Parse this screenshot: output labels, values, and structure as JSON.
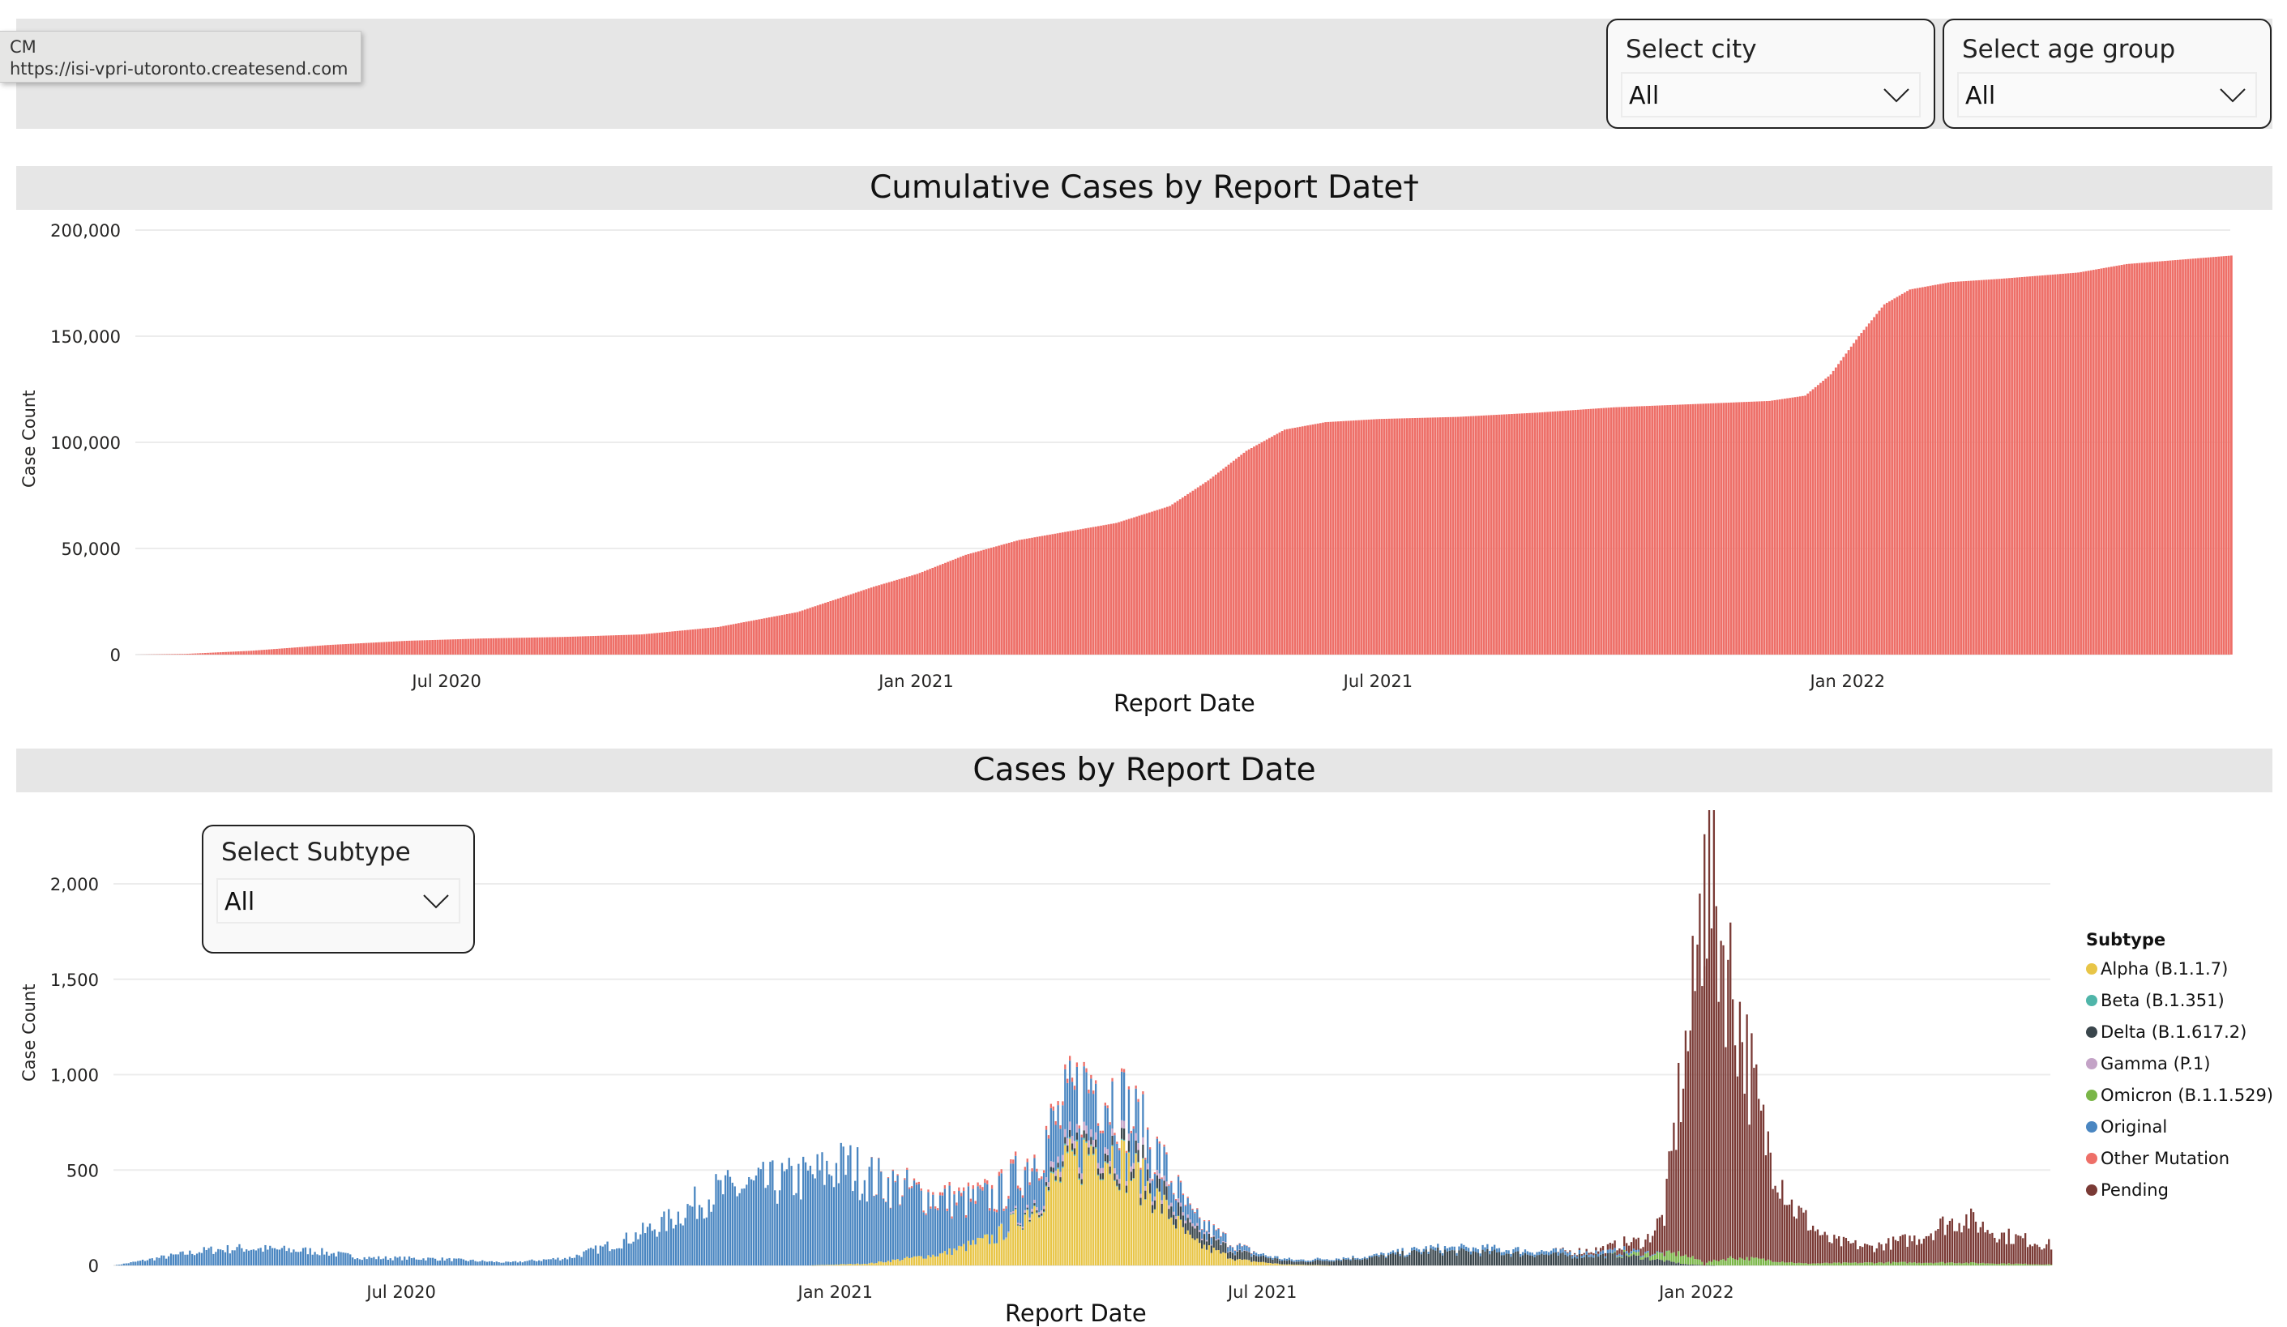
{
  "tooltip": {
    "line1": "CM",
    "line2": "https://isi-vpri-utoronto.createsend.com"
  },
  "filters": {
    "city": {
      "label": "Select city",
      "value": "All"
    },
    "age_group": {
      "label": "Select age group",
      "value": "All"
    },
    "subtype": {
      "label": "Select Subtype",
      "value": "All"
    }
  },
  "icons": {
    "dropdown": "chevron-down-icon",
    "legend_marker": "circle-icon"
  },
  "chart_data": [
    {
      "id": "cumulative",
      "type": "bar",
      "title": "Cumulative Cases by Report Date†",
      "xlabel": "Report Date",
      "ylabel": "Case Count",
      "x_range": [
        "2020-03-01",
        "2022-05-31"
      ],
      "ylim": [
        0,
        200000
      ],
      "yticks": [
        0,
        50000,
        100000,
        150000,
        200000
      ],
      "ytick_labels": [
        "0",
        "50,000",
        "100,000",
        "150,000",
        "200,000"
      ],
      "xticks": [
        "2020-07-01",
        "2021-01-01",
        "2021-07-01",
        "2022-01-01"
      ],
      "xtick_labels": [
        "Jul 2020",
        "Jan 2021",
        "Jul 2021",
        "Jan 2022"
      ],
      "grid": true,
      "color": "#EE6F68",
      "keypoints": [
        [
          "2020-03-01",
          0
        ],
        [
          "2020-03-20",
          300
        ],
        [
          "2020-04-15",
          1800
        ],
        [
          "2020-05-15",
          4500
        ],
        [
          "2020-06-15",
          6500
        ],
        [
          "2020-07-15",
          7600
        ],
        [
          "2020-08-15",
          8300
        ],
        [
          "2020-09-15",
          9500
        ],
        [
          "2020-10-15",
          13000
        ],
        [
          "2020-11-15",
          20000
        ],
        [
          "2020-12-15",
          32000
        ],
        [
          "2021-01-01",
          38000
        ],
        [
          "2021-01-20",
          47000
        ],
        [
          "2021-02-10",
          54000
        ],
        [
          "2021-03-01",
          58000
        ],
        [
          "2021-03-20",
          62000
        ],
        [
          "2021-04-10",
          70000
        ],
        [
          "2021-04-25",
          82000
        ],
        [
          "2021-05-10",
          96000
        ],
        [
          "2021-05-25",
          106000
        ],
        [
          "2021-06-10",
          109500
        ],
        [
          "2021-07-01",
          111000
        ],
        [
          "2021-08-01",
          112000
        ],
        [
          "2021-09-01",
          114000
        ],
        [
          "2021-10-01",
          116500
        ],
        [
          "2021-11-01",
          118000
        ],
        [
          "2021-12-01",
          119500
        ],
        [
          "2021-12-15",
          122000
        ],
        [
          "2021-12-25",
          132000
        ],
        [
          "2022-01-05",
          150000
        ],
        [
          "2022-01-15",
          165000
        ],
        [
          "2022-01-25",
          172000
        ],
        [
          "2022-02-10",
          175500
        ],
        [
          "2022-03-01",
          177000
        ],
        [
          "2022-04-01",
          180000
        ],
        [
          "2022-04-20",
          184000
        ],
        [
          "2022-05-31",
          188000
        ]
      ]
    },
    {
      "id": "daily",
      "type": "bar",
      "stacked": true,
      "title": "Cases by Report Date",
      "xlabel": "Report Date",
      "ylabel": "Case Count",
      "x_range": [
        "2020-03-01",
        "2022-05-31"
      ],
      "ylim": [
        0,
        2300
      ],
      "yticks": [
        0,
        500,
        1000,
        1500,
        2000
      ],
      "ytick_labels": [
        "0",
        "500",
        "1,000",
        "1,500",
        "2,000"
      ],
      "xticks": [
        "2020-07-01",
        "2021-01-01",
        "2021-07-01",
        "2022-01-01"
      ],
      "xtick_labels": [
        "Jul 2020",
        "Jan 2021",
        "Jul 2021",
        "Jan 2022"
      ],
      "grid": true,
      "legend": {
        "title": "Subtype",
        "placement": "right"
      },
      "series": [
        {
          "name": "Alpha (B.1.1.7)",
          "color": "#E8C547",
          "keypoints": [
            [
              "2020-12-20",
              0
            ],
            [
              "2021-01-15",
              10
            ],
            [
              "2021-02-15",
              60
            ],
            [
              "2021-03-10",
              150
            ],
            [
              "2021-03-25",
              300
            ],
            [
              "2021-04-10",
              520
            ],
            [
              "2021-04-20",
              620
            ],
            [
              "2021-05-01",
              560
            ],
            [
              "2021-05-15",
              380
            ],
            [
              "2021-06-01",
              120
            ],
            [
              "2021-06-20",
              30
            ],
            [
              "2021-07-10",
              5
            ],
            [
              "2021-08-01",
              0
            ]
          ]
        },
        {
          "name": "Beta (B.1.351)",
          "color": "#4FB5A9",
          "keypoints": [
            [
              "2021-03-01",
              0
            ],
            [
              "2021-04-15",
              8
            ],
            [
              "2021-05-30",
              0
            ]
          ]
        },
        {
          "name": "Delta (B.1.617.2)",
          "color": "#3A464C",
          "keypoints": [
            [
              "2021-03-15",
              0
            ],
            [
              "2021-04-20",
              40
            ],
            [
              "2021-05-20",
              60
            ],
            [
              "2021-06-15",
              45
            ],
            [
              "2021-07-15",
              15
            ],
            [
              "2021-08-15",
              40
            ],
            [
              "2021-09-10",
              75
            ],
            [
              "2021-10-10",
              65
            ],
            [
              "2021-11-10",
              50
            ],
            [
              "2021-12-01",
              55
            ],
            [
              "2021-12-15",
              30
            ],
            [
              "2021-12-28",
              5
            ],
            [
              "2022-01-10",
              0
            ]
          ]
        },
        {
          "name": "Gamma (P.1)",
          "color": "#C4A3C7",
          "keypoints": [
            [
              "2021-03-10",
              0
            ],
            [
              "2021-04-15",
              40
            ],
            [
              "2021-05-10",
              30
            ],
            [
              "2021-06-10",
              5
            ],
            [
              "2021-07-01",
              0
            ]
          ]
        },
        {
          "name": "Omicron (B.1.1.529)",
          "color": "#7AB648",
          "keypoints": [
            [
              "2021-11-25",
              0
            ],
            [
              "2021-12-10",
              20
            ],
            [
              "2021-12-25",
              50
            ],
            [
              "2022-01-05",
              15
            ],
            [
              "2022-01-15",
              40
            ],
            [
              "2022-01-25",
              35
            ],
            [
              "2022-02-15",
              10
            ],
            [
              "2022-03-20",
              15
            ],
            [
              "2022-04-20",
              15
            ],
            [
              "2022-05-31",
              5
            ]
          ]
        },
        {
          "name": "Original",
          "color": "#4A86C1",
          "keypoints": [
            [
              "2020-03-01",
              0
            ],
            [
              "2020-03-20",
              40
            ],
            [
              "2020-04-10",
              80
            ],
            [
              "2020-04-25",
              90
            ],
            [
              "2020-05-25",
              75
            ],
            [
              "2020-06-15",
              40
            ],
            [
              "2020-07-15",
              35
            ],
            [
              "2020-08-15",
              15
            ],
            [
              "2020-09-10",
              40
            ],
            [
              "2020-10-01",
              120
            ],
            [
              "2020-10-20",
              220
            ],
            [
              "2020-11-10",
              380
            ],
            [
              "2020-12-01",
              420
            ],
            [
              "2020-12-20",
              460
            ],
            [
              "2021-01-05",
              520
            ],
            [
              "2021-01-20",
              420
            ],
            [
              "2021-02-05",
              330
            ],
            [
              "2021-02-25",
              230
            ],
            [
              "2021-03-15",
              200
            ],
            [
              "2021-04-10",
              250
            ],
            [
              "2021-04-20",
              260
            ],
            [
              "2021-05-10",
              180
            ],
            [
              "2021-06-01",
              60
            ],
            [
              "2021-07-01",
              10
            ],
            [
              "2021-08-15",
              8
            ],
            [
              "2021-10-01",
              20
            ],
            [
              "2021-12-01",
              15
            ],
            [
              "2021-12-20",
              0
            ]
          ]
        },
        {
          "name": "Other Mutation",
          "color": "#EE6F68",
          "keypoints": [
            [
              "2021-01-15",
              0
            ],
            [
              "2021-02-15",
              15
            ],
            [
              "2021-04-15",
              20
            ],
            [
              "2021-06-01",
              5
            ],
            [
              "2021-07-01",
              0
            ]
          ]
        },
        {
          "name": "Pending",
          "color": "#7A3A35",
          "keypoints": [
            [
              "2021-11-01",
              0
            ],
            [
              "2021-11-20",
              15
            ],
            [
              "2021-12-10",
              60
            ],
            [
              "2021-12-18",
              200
            ],
            [
              "2021-12-24",
              800
            ],
            [
              "2021-12-30",
              1300
            ],
            [
              "2022-01-03",
              1900
            ],
            [
              "2022-01-06",
              2000
            ],
            [
              "2022-01-10",
              1750
            ],
            [
              "2022-01-18",
              1300
            ],
            [
              "2022-01-28",
              700
            ],
            [
              "2022-02-10",
              300
            ],
            [
              "2022-02-25",
              120
            ],
            [
              "2022-03-15",
              80
            ],
            [
              "2022-04-05",
              130
            ],
            [
              "2022-04-15",
              200
            ],
            [
              "2022-04-25",
              230
            ],
            [
              "2022-05-10",
              150
            ],
            [
              "2022-05-31",
              100
            ]
          ]
        }
      ],
      "peak": {
        "date": "2022-01-04",
        "value": 2260
      }
    }
  ]
}
